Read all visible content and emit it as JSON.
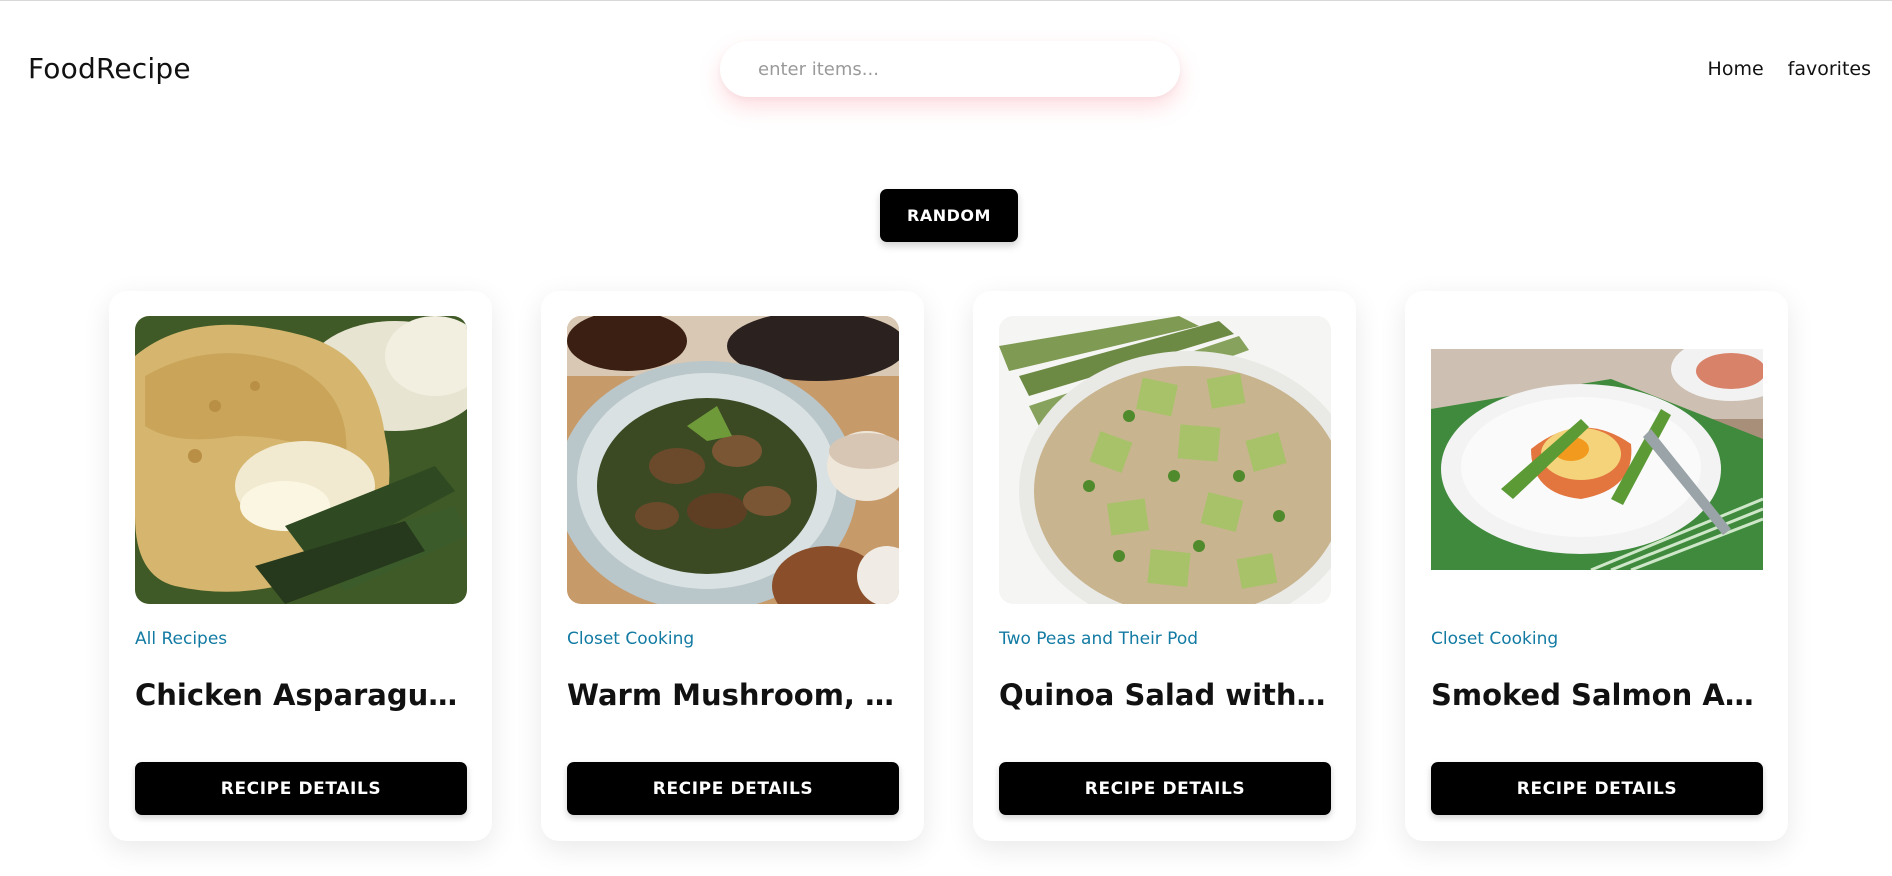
{
  "header": {
    "logo": "FoodRecipe",
    "search_placeholder": "enter items...",
    "search_value": "",
    "nav": [
      {
        "label": "Home"
      },
      {
        "label": "favorites"
      }
    ]
  },
  "random_label": "RANDOM",
  "recipes": [
    {
      "source": "All Recipes",
      "title": "Chicken Asparagus Ro...",
      "button": "RECIPE DETAILS"
    },
    {
      "source": "Closet Cooking",
      "title": "Warm Mushroom, Roa...",
      "button": "RECIPE DETAILS"
    },
    {
      "source": "Two Peas and Their Pod",
      "title": "Quinoa Salad with Asp...",
      "button": "RECIPE DETAILS"
    },
    {
      "source": "Closet Cooking",
      "title": "Smoked Salmon Aspar...",
      "button": "RECIPE DETAILS"
    }
  ],
  "colors": {
    "accent_link": "#137ba3",
    "button_bg": "#000000",
    "button_text": "#ffffff",
    "search_glow": "#ff6478"
  }
}
